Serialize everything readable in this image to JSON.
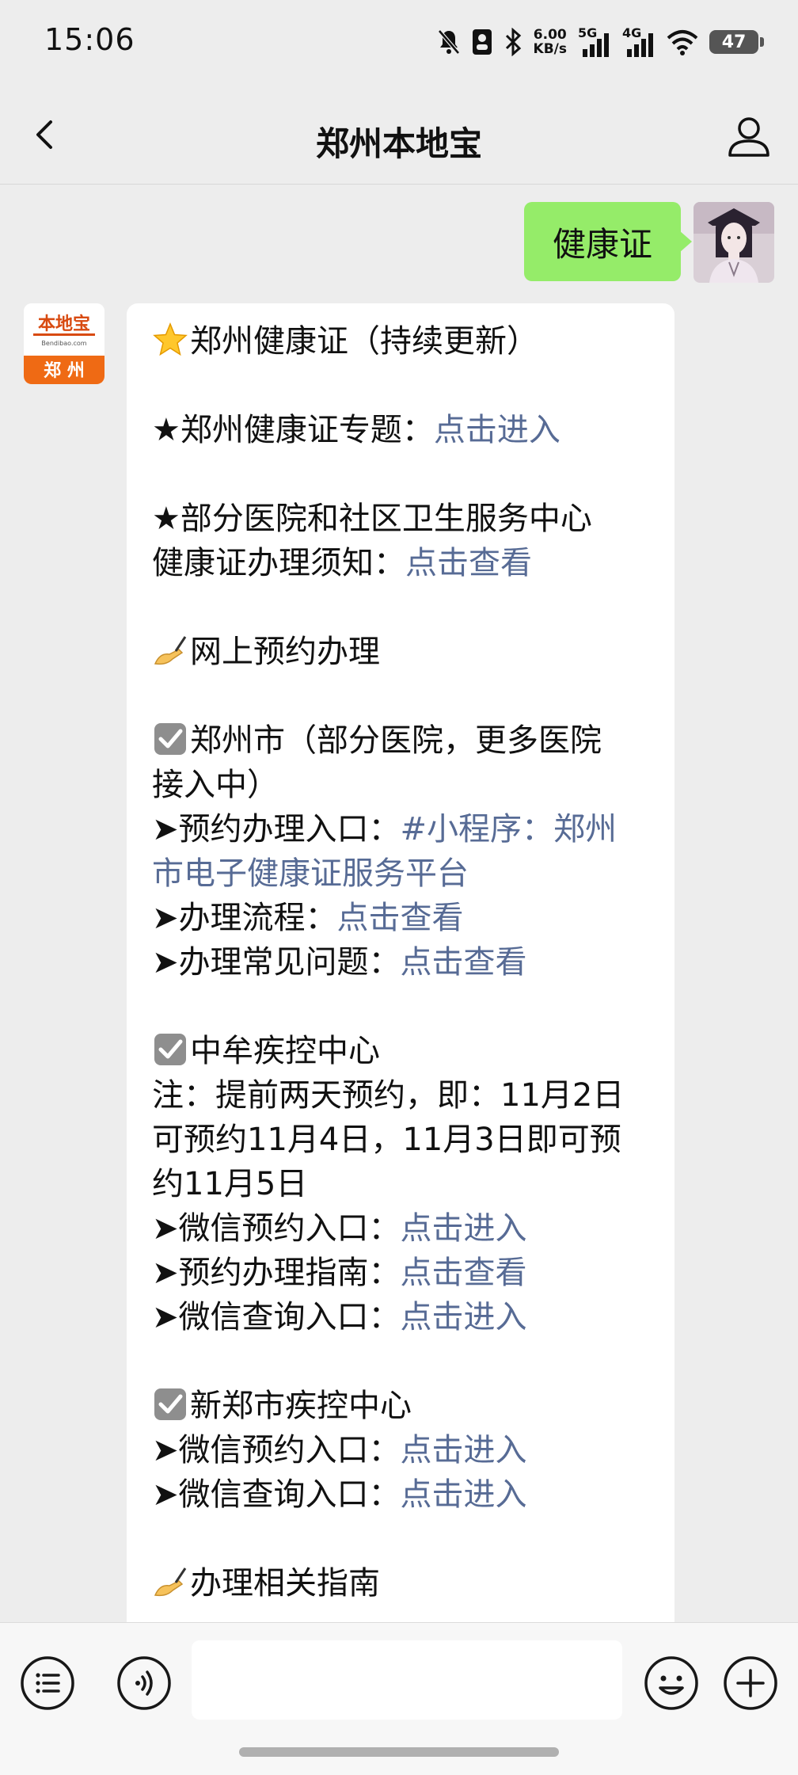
{
  "status_bar": {
    "time": "15:06",
    "speed_value": "6.00",
    "speed_unit": "KB/s",
    "net1": "5G",
    "net2": "4G",
    "battery": "47",
    "icons": [
      "mute-bell-icon",
      "portrait-icon",
      "bluetooth-icon",
      "signal-icon",
      "wifi-icon",
      "battery-icon"
    ]
  },
  "nav": {
    "title": "郑州本地宝",
    "back_icon": "chevron-left-icon",
    "profile_icon": "person-icon"
  },
  "user_message": {
    "text": "健康证"
  },
  "bot_avatar": {
    "logo_text": "本地宝",
    "logo_sub": "Bendibao.com",
    "city": "郑 州"
  },
  "bot_message": {
    "title": "郑州健康证（持续更新）",
    "s1_text": "★郑州健康证专题：",
    "s1_link": "点击进入",
    "s2_line1": "★部分医院和社区卫生服务中心",
    "s2_text": "健康证办理须知：",
    "s2_link": "点击查看",
    "s3_title": "网上预约办理",
    "zz_title": "郑州市（部分医院，更多医院",
    "zz_title2": "接入中）",
    "zz_entry_text": "预约办理入口：",
    "zz_entry_link1": "#小程序：郑州",
    "zz_entry_link2": "市电子健康证服务平台",
    "zz_flow_text": "办理流程：",
    "zz_flow_link": "点击查看",
    "zz_faq_text": "办理常见问题：",
    "zz_faq_link": "点击查看",
    "zm_title": "中牟疾控中心",
    "zm_note1": "注：提前两天预约，即：11月2日",
    "zm_note2": "可预约11月4日，11月3日即可预",
    "zm_note3": "约11月5日",
    "zm_wx_text": "微信预约入口：",
    "zm_wx_link": "点击进入",
    "zm_guide_text": "预约办理指南：",
    "zm_guide_link": "点击查看",
    "zm_query_text": "微信查询入口：",
    "zm_query_link": "点击进入",
    "xz_title": "新郑市疾控中心",
    "xz_wx_text": "微信预约入口：",
    "xz_wx_link": "点击进入",
    "xz_query_text": "微信查询入口：",
    "xz_query_link": "点击进入",
    "s4_title_partial": "办理相关指南"
  },
  "input_bar": {
    "left_icons": [
      "menu-list-icon",
      "voice-icon"
    ],
    "right_icons": [
      "emoji-icon",
      "plus-icon"
    ]
  }
}
